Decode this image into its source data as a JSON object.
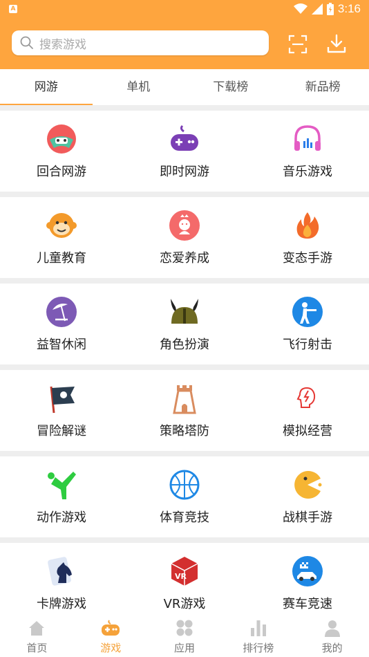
{
  "status_bar": {
    "time": "3:16"
  },
  "search": {
    "placeholder": "搜索游戏"
  },
  "tabs": [
    {
      "label": "网游",
      "active": true
    },
    {
      "label": "单机",
      "active": false
    },
    {
      "label": "下载榜",
      "active": false
    },
    {
      "label": "新品榜",
      "active": false
    }
  ],
  "categories": [
    [
      {
        "label": "回合网游",
        "icon": "turn-based-icon"
      },
      {
        "label": "即时网游",
        "icon": "gamepad-icon"
      },
      {
        "label": "音乐游戏",
        "icon": "headphones-icon"
      }
    ],
    [
      {
        "label": "儿童教育",
        "icon": "monkey-face-icon"
      },
      {
        "label": "恋爱养成",
        "icon": "princess-icon"
      },
      {
        "label": "变态手游",
        "icon": "flame-icon"
      }
    ],
    [
      {
        "label": "益智休闲",
        "icon": "beach-umbrella-icon"
      },
      {
        "label": "角色扮演",
        "icon": "viking-helmet-icon"
      },
      {
        "label": "飞行射击",
        "icon": "shooter-icon"
      }
    ],
    [
      {
        "label": "冒险解谜",
        "icon": "pirate-flag-icon"
      },
      {
        "label": "策略塔防",
        "icon": "tower-icon"
      },
      {
        "label": "模拟经营",
        "icon": "brain-icon"
      }
    ],
    [
      {
        "label": "动作游戏",
        "icon": "kick-icon"
      },
      {
        "label": "体育竞技",
        "icon": "basketball-icon"
      },
      {
        "label": "战棋手游",
        "icon": "pacman-icon"
      }
    ],
    [
      {
        "label": "卡牌游戏",
        "icon": "knight-card-icon"
      },
      {
        "label": "VR游戏",
        "icon": "vr-cube-icon"
      },
      {
        "label": "赛车竞速",
        "icon": "race-car-icon"
      }
    ]
  ],
  "bottom_nav": [
    {
      "label": "首页",
      "icon": "home-icon",
      "active": false
    },
    {
      "label": "游戏",
      "icon": "game-controller-icon",
      "active": true
    },
    {
      "label": "应用",
      "icon": "apps-icon",
      "active": false
    },
    {
      "label": "排行榜",
      "icon": "bar-chart-icon",
      "active": false
    },
    {
      "label": "我的",
      "icon": "person-icon",
      "active": false
    }
  ],
  "colors": {
    "accent": "#fea53e",
    "active_nav": "#f5a23a"
  }
}
